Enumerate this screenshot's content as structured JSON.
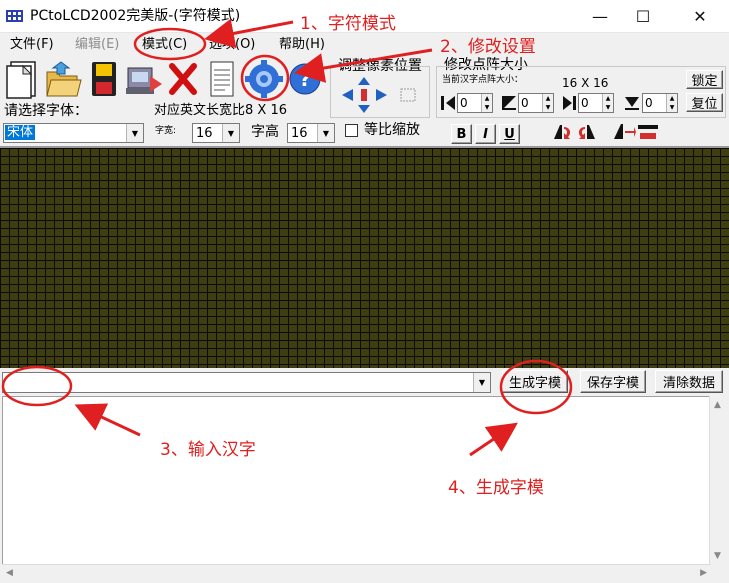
{
  "window": {
    "title": "PCtoLCD2002完美版-(字符模式)",
    "minimize": "—",
    "maximize": "☐",
    "close": "✕"
  },
  "menu": {
    "file": "文件(F)",
    "edit": "编辑(E)",
    "mode": "模式(C)",
    "options": "选项(O)",
    "help": "帮助(H)"
  },
  "font_panel": {
    "choose_font_label": "请选择字体：",
    "ratio_label": "对应英文长宽比8 X 16",
    "font_value": "宋体",
    "width_label": "字宽:",
    "width_value": "16",
    "height_label": "字高",
    "height_value": "16",
    "proportional_label": "等比缩放",
    "bold": "B",
    "italic": "I",
    "underline": "U"
  },
  "pixel_adjust": {
    "title": "调整像素位置"
  },
  "dot_size": {
    "title": "修改点阵大小",
    "current_label": "当前汉字点阵大小：",
    "current_value": "16 X 16",
    "lock_button": "锁定",
    "reset_button": "复位",
    "spin_values": [
      "0",
      "0",
      "0",
      "0"
    ]
  },
  "actions": {
    "generate": "生成字模",
    "save": "保存字模",
    "clear": "清除数据"
  },
  "annotations": {
    "a1": "1、字符模式",
    "a2": "2、修改设置",
    "a3": "3、输入汉字",
    "a4": "4、生成字模"
  },
  "colors": {
    "annotation": "#e02020",
    "grid_cell": "#3e3e12",
    "grid_line": "#0b0b05",
    "selection": "#0078d7"
  }
}
